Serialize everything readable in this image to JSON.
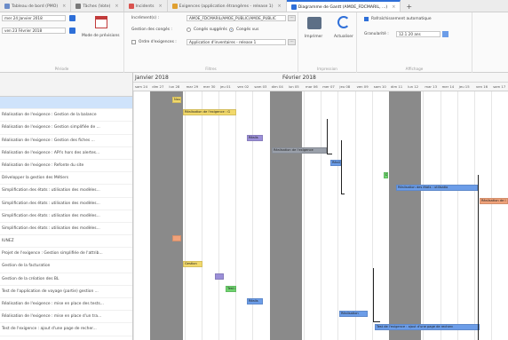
{
  "tabs": [
    {
      "label": "Tableau de bord (PMO)",
      "icon": "grid-icon",
      "color": "#6b8cc9",
      "active": false
    },
    {
      "label": "Tâches (Vote)",
      "icon": "tasks-icon",
      "color": "#7a7a7a",
      "active": false
    },
    {
      "label": "Incidents",
      "icon": "bug-icon",
      "color": "#d9534f",
      "active": false
    },
    {
      "label": "Exigences (application étrangères - release 1)",
      "icon": "pencil-icon",
      "color": "#e0a030",
      "active": false
    },
    {
      "label": "Diagramme de Gantt (AMOE_FDCMARIL, ...)",
      "icon": "gantt-icon",
      "color": "#2e6fd8",
      "active": true
    }
  ],
  "ribbon": {
    "period": {
      "date_from": "mer 24 Janvier 2018",
      "date_to": "ven 23 Février 2018",
      "recent_label": "Mode de prévisions",
      "group_label": "Période"
    },
    "filters": {
      "increment_label": "Incrément(s) :",
      "increment_value": "AMOE_FDCMARIL/AMOE_PUBLIC/AMOE_PUBLIC",
      "manage_label": "Gestion des congés :",
      "suggested_label": "Congés suggérés",
      "validated_label": "Congés vus",
      "sort_label": "Ordre d'exigences :",
      "sort_value": "Application d'inventaires - release 1",
      "dots": "...",
      "group_label": "Filtres"
    },
    "export": {
      "print_label": "Imprimer",
      "group_label": "Impression"
    },
    "refresh": {
      "label": "Actualiser"
    },
    "display": {
      "auto_refresh_label": "Rafraîchissement automatique",
      "granularity_label": "Granularité :",
      "granularity_value": "12.1 20 ans",
      "group_label": "Affichage"
    }
  },
  "tasklist": {
    "rows": [
      "",
      "Réalisation de l'exigence : Gestion de la balance",
      "Réalisation de l'exigence : Gestion simplifiée de ...",
      "Réalisation de l'exigence : Gestion des fiches ...",
      "Réalisation de l'exigence : API's hors des alertes...",
      "Réalisation de l'exigence : Refonte du site",
      "Développer la gestion des Métiers",
      "Simplification des états : utilisation des modèles...",
      "Simplification des états : utilisation des modèles...",
      "Simplification des états : utilisation des modèles...",
      "Simplification des états : utilisation des modèles...",
      "IUNEZ",
      "Projet de l'exigence : Gestion simplifiée de l'attrib...",
      "Gestion de la facturation",
      "Gestion de la création des BL",
      "Test de l'application de voyage (partie) gestion ...",
      "Réalisation de l'exigence : mise en place des tests...",
      "Réalisation de l'exigence : mise en place d'un tra...",
      "Test de l'exigence : ajout d'une page de recher..."
    ]
  },
  "gantt": {
    "months": [
      "Janvier 2018",
      "Février 2018"
    ],
    "days": [
      "sam 24",
      "dim 27",
      "lun 28",
      "mar 29",
      "mer 30",
      "jeu 01",
      "ven 02",
      "sam 03",
      "dim 04",
      "lun 05",
      "mar 06",
      "mer 07",
      "jeu 08",
      "ven 09",
      "sam 10",
      "dim 11",
      "lun 12",
      "mar 13",
      "mer 14",
      "jeu 15",
      "ven 16",
      "sam 17"
    ],
    "bars": [
      {
        "label": "Nou",
        "color": "#f2d96b"
      },
      {
        "label": "Réalisation de l'exigence : G",
        "color": "#f2d96b"
      },
      {
        "label": "Réalis",
        "color": "#9b8fd8"
      },
      {
        "label": "Réalisation de l'exigence",
        "color": "#9aa0aa"
      },
      {
        "label": "Réalis",
        "color": "#6c9de8"
      },
      {
        "label": "Dév",
        "color": "#6fd46f"
      },
      {
        "label": "Réalisation des états : utilisatio",
        "color": "#6c9de8"
      },
      {
        "label": "Réalisation de l",
        "color": "#f0a27a"
      },
      {
        "label": "",
        "color": "#f0a27a"
      },
      {
        "label": "Gestion",
        "color": "#f2d96b"
      },
      {
        "label": "",
        "color": "#9b8fd8"
      },
      {
        "label": "Test de l",
        "color": "#6fd46f"
      },
      {
        "label": "Réalis",
        "color": "#6c9de8"
      },
      {
        "label": "Réalisation",
        "color": "#6c9de8"
      },
      {
        "label": "Test de l'exigence : ajout d'une page de recherc",
        "color": "#6c9de8"
      }
    ]
  }
}
